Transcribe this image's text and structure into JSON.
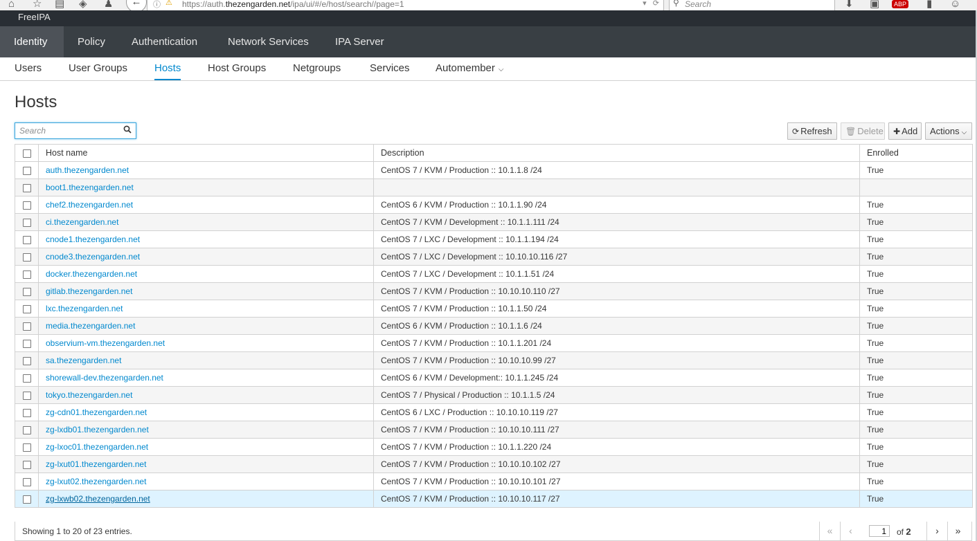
{
  "browser": {
    "url_prefix": "https://auth.",
    "url_domain": "thezengarden.net",
    "url_suffix": "/ipa/ui/#/e/host/search//page=1",
    "search_placeholder": "Search",
    "abp_label": "ABP"
  },
  "masthead": {
    "brand": "FreeIPA"
  },
  "primary_nav": [
    {
      "label": "Identity",
      "active": true
    },
    {
      "label": "Policy"
    },
    {
      "label": "Authentication"
    },
    {
      "label": "Network Services"
    },
    {
      "label": "IPA Server"
    }
  ],
  "secondary_nav": [
    {
      "label": "Users"
    },
    {
      "label": "User Groups"
    },
    {
      "label": "Hosts",
      "active": true
    },
    {
      "label": "Host Groups"
    },
    {
      "label": "Netgroups"
    },
    {
      "label": "Services"
    },
    {
      "label": "Automember"
    }
  ],
  "page": {
    "title": "Hosts",
    "search_placeholder": "Search"
  },
  "toolbar": {
    "refresh": "Refresh",
    "delete": "Delete",
    "add": "Add",
    "actions": "Actions"
  },
  "table": {
    "columns": [
      "Host name",
      "Description",
      "Enrolled"
    ],
    "rows": [
      {
        "host": "auth.thezengarden.net",
        "desc": "CentOS 7 / KVM / Production :: 10.1.1.8 /24",
        "enrolled": "True"
      },
      {
        "host": "boot1.thezengarden.net",
        "desc": "",
        "enrolled": ""
      },
      {
        "host": "chef2.thezengarden.net",
        "desc": "CentOS 6 / KVM / Production :: 10.1.1.90 /24",
        "enrolled": "True"
      },
      {
        "host": "ci.thezengarden.net",
        "desc": "CentOS 7 / KVM / Development :: 10.1.1.111 /24",
        "enrolled": "True"
      },
      {
        "host": "cnode1.thezengarden.net",
        "desc": "CentOS 7 / LXC / Development :: 10.1.1.194 /24",
        "enrolled": "True"
      },
      {
        "host": "cnode3.thezengarden.net",
        "desc": "CentOS 7 / LXC / Development :: 10.10.10.116 /27",
        "enrolled": "True"
      },
      {
        "host": "docker.thezengarden.net",
        "desc": "CentOS 7 / LXC / Development :: 10.1.1.51 /24",
        "enrolled": "True"
      },
      {
        "host": "gitlab.thezengarden.net",
        "desc": "CentOS 7 / KVM / Production :: 10.10.10.110 /27",
        "enrolled": "True"
      },
      {
        "host": "lxc.thezengarden.net",
        "desc": "CentOS 7 / KVM / Production :: 10.1.1.50 /24",
        "enrolled": "True"
      },
      {
        "host": "media.thezengarden.net",
        "desc": "CentOS 6 / KVM / Production :: 10.1.1.6 /24",
        "enrolled": "True"
      },
      {
        "host": "observium-vm.thezengarden.net",
        "desc": "CentOS 7 / KVM / Production :: 10.1.1.201 /24",
        "enrolled": "True"
      },
      {
        "host": "sa.thezengarden.net",
        "desc": "CentOS 7 / KVM / Production :: 10.10.10.99 /27",
        "enrolled": "True"
      },
      {
        "host": "shorewall-dev.thezengarden.net",
        "desc": "CentOS 6 / KVM / Development:: 10.1.1.245 /24",
        "enrolled": "True"
      },
      {
        "host": "tokyo.thezengarden.net",
        "desc": "CentOS 7 / Physical / Production :: 10.1.1.5 /24",
        "enrolled": "True"
      },
      {
        "host": "zg-cdn01.thezengarden.net",
        "desc": "CentOS 6 / LXC / Production :: 10.10.10.119 /27",
        "enrolled": "True"
      },
      {
        "host": "zg-lxdb01.thezengarden.net",
        "desc": "CentOS 7 / KVM / Production :: 10.10.10.111 /27",
        "enrolled": "True"
      },
      {
        "host": "zg-lxoc01.thezengarden.net",
        "desc": "CentOS 7 / KVM / Production :: 10.1.1.220 /24",
        "enrolled": "True"
      },
      {
        "host": "zg-lxut01.thezengarden.net",
        "desc": "CentOS 7 / KVM / Production :: 10.10.10.102 /27",
        "enrolled": "True"
      },
      {
        "host": "zg-lxut02.thezengarden.net",
        "desc": "CentOS 7 / KVM / Production :: 10.10.10.101 /27",
        "enrolled": "True"
      },
      {
        "host": "zg-lxwb02.thezengarden.net",
        "desc": "CentOS 7 / KVM / Production :: 10.10.10.117 /27",
        "enrolled": "True",
        "selected": true
      }
    ]
  },
  "footer": {
    "summary": "Showing 1 to 20 of 23 entries.",
    "current_page": "1",
    "of_label": "of",
    "total_pages": "2"
  },
  "colors": {
    "masthead": "#292e34",
    "primary_nav": "#393f44",
    "primary_nav_active": "#4d5258",
    "link": "#0088ce",
    "selected_row": "#def3ff"
  }
}
